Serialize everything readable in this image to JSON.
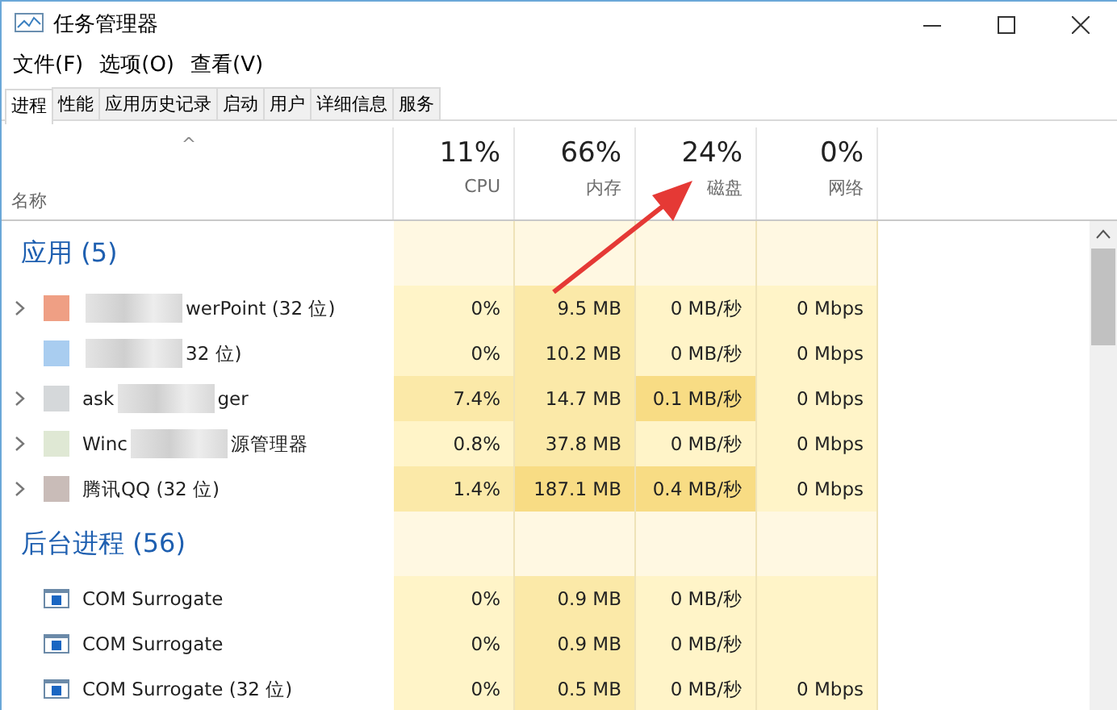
{
  "window": {
    "title": "任务管理器"
  },
  "menu": [
    "文件(F)",
    "选项(O)",
    "查看(V)"
  ],
  "tabs": [
    {
      "label": "进程",
      "selected": true
    },
    {
      "label": "性能",
      "selected": false
    },
    {
      "label": "应用历史记录",
      "selected": false
    },
    {
      "label": "启动",
      "selected": false
    },
    {
      "label": "用户",
      "selected": false
    },
    {
      "label": "详细信息",
      "selected": false
    },
    {
      "label": "服务",
      "selected": false
    }
  ],
  "table": {
    "name_column": {
      "sort_indicator": "^",
      "label": "名称"
    },
    "columns": [
      {
        "percent": "11%",
        "label": "CPU"
      },
      {
        "percent": "66%",
        "label": "内存"
      },
      {
        "percent": "24%",
        "label": "磁盘"
      },
      {
        "percent": "0%",
        "label": "网络"
      }
    ],
    "rows": [
      {
        "kind": "group",
        "title": "应用 (5)"
      },
      {
        "kind": "process",
        "expandable": true,
        "icon": {
          "kind": "app",
          "color": "#ef9f84"
        },
        "name_parts": [
          {
            "kind": "blur"
          },
          {
            "kind": "text",
            "text": "werPoint (32 位)"
          }
        ],
        "cells": [
          {
            "text": "0%",
            "color": "#fff4c8"
          },
          {
            "text": "9.5 MB",
            "color": "#fbe9a8"
          },
          {
            "text": "0 MB/秒",
            "color": "#fff4c8"
          },
          {
            "text": "0 Mbps",
            "color": "#fff4c8"
          }
        ]
      },
      {
        "kind": "process",
        "expandable": false,
        "icon": {
          "kind": "app",
          "color": "#a9cdf0"
        },
        "name_parts": [
          {
            "kind": "blur"
          },
          {
            "kind": "text",
            "text": "32 位)"
          }
        ],
        "cells": [
          {
            "text": "0%",
            "color": "#fff4c8"
          },
          {
            "text": "10.2 MB",
            "color": "#fbe9a8"
          },
          {
            "text": "0 MB/秒",
            "color": "#fff4c8"
          },
          {
            "text": "0 Mbps",
            "color": "#fff4c8"
          }
        ]
      },
      {
        "kind": "process",
        "expandable": true,
        "icon": {
          "kind": "app",
          "color": "#d5d8da"
        },
        "name_parts": [
          {
            "kind": "text",
            "text": "ask"
          },
          {
            "kind": "blur"
          },
          {
            "kind": "text",
            "text": "ger"
          }
        ],
        "cells": [
          {
            "text": "7.4%",
            "color": "#fbe9a8"
          },
          {
            "text": "14.7 MB",
            "color": "#fbe9a8"
          },
          {
            "text": "0.1 MB/秒",
            "color": "#f8dc84"
          },
          {
            "text": "0 Mbps",
            "color": "#fff4c8"
          }
        ]
      },
      {
        "kind": "process",
        "expandable": true,
        "icon": {
          "kind": "app",
          "color": "#dfe8d4"
        },
        "name_parts": [
          {
            "kind": "text",
            "text": "Winc"
          },
          {
            "kind": "blur"
          },
          {
            "kind": "text",
            "text": "源管理器"
          }
        ],
        "cells": [
          {
            "text": "0.8%",
            "color": "#fff4c8"
          },
          {
            "text": "37.8 MB",
            "color": "#fbe9a8"
          },
          {
            "text": "0 MB/秒",
            "color": "#fff4c8"
          },
          {
            "text": "0 Mbps",
            "color": "#fff4c8"
          }
        ]
      },
      {
        "kind": "process",
        "expandable": true,
        "icon": {
          "kind": "app",
          "color": "#c9bcb8"
        },
        "name_parts": [
          {
            "kind": "text",
            "text": "腾讯QQ (32 位)"
          }
        ],
        "cells": [
          {
            "text": "1.4%",
            "color": "#fbe9a8"
          },
          {
            "text": "187.1 MB",
            "color": "#f8dc84"
          },
          {
            "text": "0.4 MB/秒",
            "color": "#f8dc84"
          },
          {
            "text": "0 Mbps",
            "color": "#fff4c8"
          }
        ]
      },
      {
        "kind": "group",
        "title": "后台进程 (56)"
      },
      {
        "kind": "process",
        "expandable": false,
        "icon": {
          "kind": "window"
        },
        "name_parts": [
          {
            "kind": "text",
            "text": "COM Surrogate"
          }
        ],
        "cells": [
          {
            "text": "0%",
            "color": "#fff4c8"
          },
          {
            "text": "0.9 MB",
            "color": "#fbe9a8"
          },
          {
            "text": "0 MB/秒",
            "color": "#fff4c8"
          },
          {
            "color": "#fff4c8"
          }
        ]
      },
      {
        "kind": "process",
        "expandable": false,
        "icon": {
          "kind": "window"
        },
        "name_parts": [
          {
            "kind": "text",
            "text": "COM Surrogate"
          }
        ],
        "cells": [
          {
            "text": "0%",
            "color": "#fff4c8"
          },
          {
            "text": "0.9 MB",
            "color": "#fbe9a8"
          },
          {
            "text": "0 MB/秒",
            "color": "#fff4c8"
          },
          {
            "color": "#fff4c8"
          }
        ]
      },
      {
        "kind": "process",
        "expandable": false,
        "icon": {
          "kind": "window"
        },
        "name_parts": [
          {
            "kind": "text",
            "text": "COM Surrogate (32 位)"
          }
        ],
        "cells": [
          {
            "text": "0%",
            "color": "#fff4c8"
          },
          {
            "text": "0.5 MB",
            "color": "#fbe9a8"
          },
          {
            "text": "0 MB/秒",
            "color": "#fff4c8"
          },
          {
            "text": "0 Mbps",
            "color": "#fff4c8"
          }
        ]
      }
    ]
  }
}
